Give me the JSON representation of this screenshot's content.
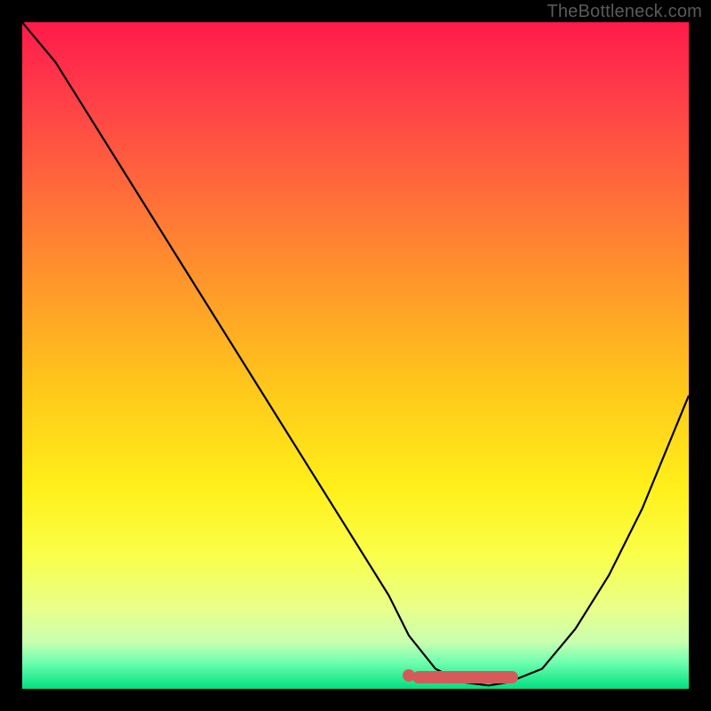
{
  "watermark": "TheBottleneck.com",
  "colors": {
    "curve": "#000000",
    "marker": "#d65a5a"
  },
  "chart_data": {
    "type": "line",
    "title": "",
    "xlabel": "",
    "ylabel": "",
    "xlim": [
      0,
      100
    ],
    "ylim": [
      0,
      100
    ],
    "series": [
      {
        "name": "bottleneck-curve",
        "x": [
          0,
          5,
          10,
          15,
          20,
          25,
          30,
          35,
          40,
          45,
          50,
          55,
          58,
          62,
          66,
          70,
          73,
          78,
          83,
          88,
          93,
          100
        ],
        "y": [
          100,
          94,
          86,
          78,
          70,
          62,
          54,
          46,
          38,
          30,
          22,
          14,
          8,
          3,
          1,
          0.5,
          1,
          3,
          9,
          17,
          27,
          44
        ]
      }
    ],
    "markers": {
      "name": "highlight-segment",
      "x_start": 58,
      "x_end": 73,
      "y": 2
    }
  }
}
